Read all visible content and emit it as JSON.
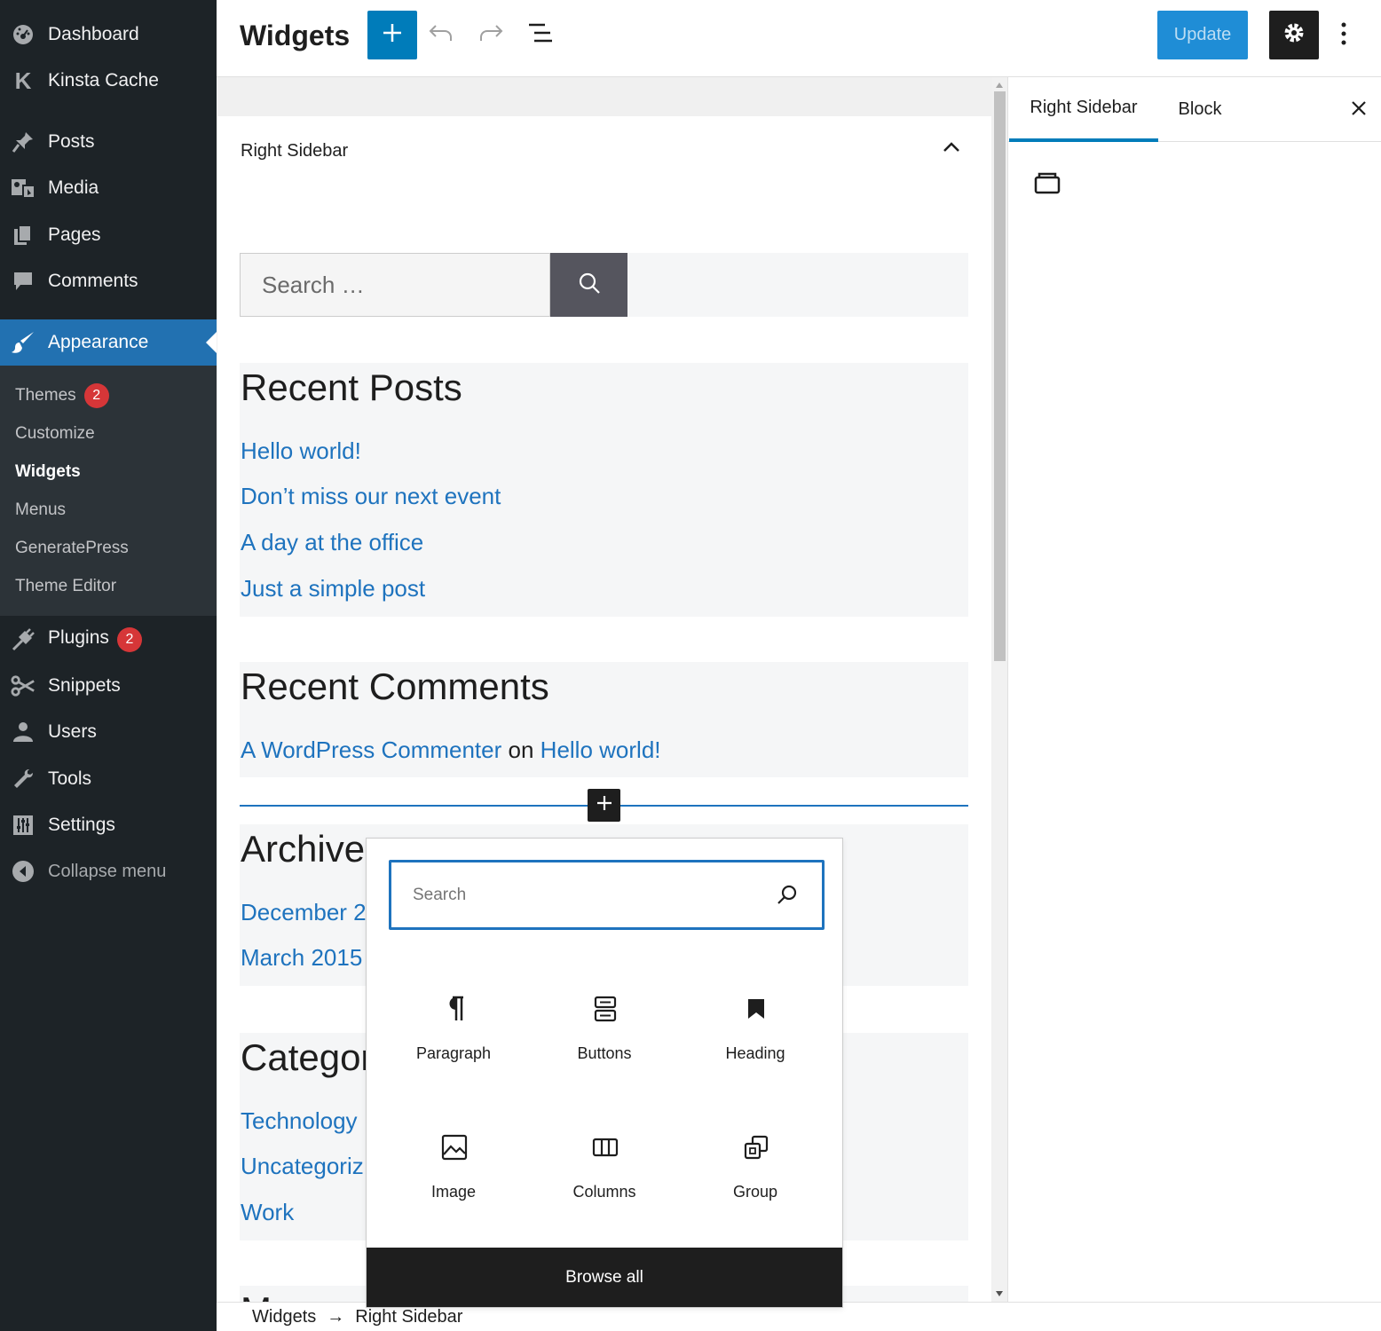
{
  "admin_menu": {
    "items": [
      {
        "label": "Dashboard",
        "icon": "dashboard-icon"
      },
      {
        "label": "Kinsta Cache",
        "icon": "kinsta-icon"
      },
      {
        "label": "Posts",
        "icon": "pushpin-icon"
      },
      {
        "label": "Media",
        "icon": "media-icon"
      },
      {
        "label": "Pages",
        "icon": "pages-icon"
      },
      {
        "label": "Comments",
        "icon": "comment-icon"
      },
      {
        "label": "Appearance",
        "icon": "paintbrush-icon"
      },
      {
        "label": "Plugins",
        "icon": "plug-icon",
        "badge": "2"
      },
      {
        "label": "Snippets",
        "icon": "scissors-icon"
      },
      {
        "label": "Users",
        "icon": "user-icon"
      },
      {
        "label": "Tools",
        "icon": "wrench-icon"
      },
      {
        "label": "Settings",
        "icon": "sliders-icon"
      },
      {
        "label": "Collapse menu",
        "icon": "collapse-icon"
      }
    ],
    "submenu": [
      {
        "label": "Themes",
        "badge": "2"
      },
      {
        "label": "Customize"
      },
      {
        "label": "Widgets"
      },
      {
        "label": "Menus"
      },
      {
        "label": "GeneratePress"
      },
      {
        "label": "Theme Editor"
      }
    ]
  },
  "header": {
    "title": "Widgets",
    "update_label": "Update"
  },
  "widget_area": {
    "title": "Right Sidebar",
    "search_placeholder": "Search …",
    "recent_posts": {
      "heading": "Recent Posts",
      "links": [
        "Hello world!",
        "Don’t miss our next event",
        "A day at the office",
        "Just a simple post"
      ]
    },
    "recent_comments": {
      "heading": "Recent Comments",
      "author": "A WordPress Commenter",
      "connector": "on",
      "post": "Hello world!"
    },
    "archives": {
      "heading": "Archives",
      "links": [
        "December 2",
        "March 2015"
      ]
    },
    "categories": {
      "heading": "Categor",
      "links": [
        "Technology",
        "Uncategoriz",
        "Work"
      ]
    },
    "meta_heading_partial": "M"
  },
  "settings_panel": {
    "tabs": [
      "Right Sidebar",
      "Block"
    ]
  },
  "inserter": {
    "search_placeholder": "Search",
    "blocks": [
      {
        "label": "Paragraph",
        "icon": "paragraph-icon"
      },
      {
        "label": "Buttons",
        "icon": "buttons-icon"
      },
      {
        "label": "Heading",
        "icon": "bookmark-icon"
      },
      {
        "label": "Image",
        "icon": "image-icon"
      },
      {
        "label": "Columns",
        "icon": "columns-icon"
      },
      {
        "label": "Group",
        "icon": "group-icon"
      }
    ],
    "browse_all": "Browse all"
  },
  "breadcrumb": {
    "items": [
      "Widgets",
      "Right Sidebar"
    ],
    "separator": "→"
  },
  "colors": {
    "admin_bg": "#1d2327",
    "submenu_bg": "#2c3338",
    "accent": "#2271b1",
    "link": "#1e73be",
    "badge": "#d63638"
  }
}
